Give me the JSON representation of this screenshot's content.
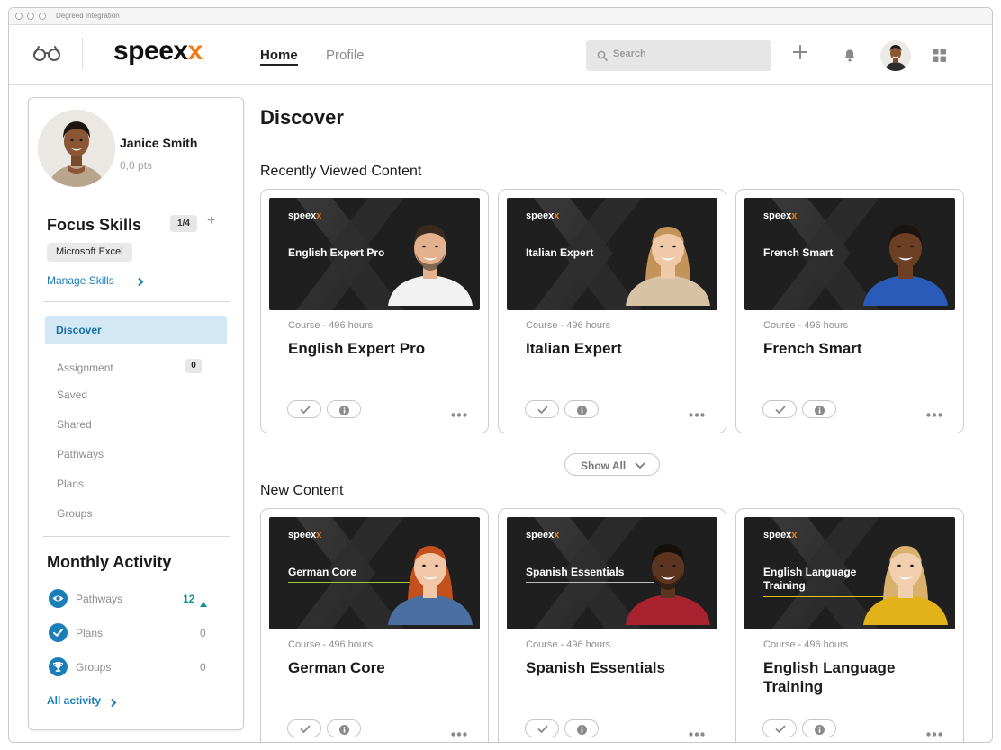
{
  "window": {
    "title": "Degreed Integration"
  },
  "brand": {
    "logo_main": "speex",
    "logo_accent": "x",
    "accent_color": "#f07c16",
    "link_color": "#1a7fb8"
  },
  "nav": {
    "home": "Home",
    "profile": "Profile"
  },
  "search": {
    "placeholder": "Search"
  },
  "icons": [
    "glasses-icon",
    "plus-icon",
    "bell-icon",
    "apps-grid-icon",
    "search-icon",
    "eye-icon",
    "check-icon",
    "trophy-icon",
    "chevron-right-icon",
    "chevron-down-icon",
    "info-icon",
    "more-icon"
  ],
  "profile": {
    "name": "Janice Smith",
    "points": "0,0 pts"
  },
  "focus_skills": {
    "title": "Focus Skills",
    "count": "1/4",
    "add": "+",
    "skills": [
      "Microsoft Excel"
    ],
    "manage_label": "Manage Skills"
  },
  "menu": {
    "active": "Discover",
    "items": [
      {
        "label": "Assignment",
        "badge": "0"
      },
      {
        "label": "Saved"
      },
      {
        "label": "Shared"
      },
      {
        "label": "Pathways"
      },
      {
        "label": "Plans"
      },
      {
        "label": "Groups"
      }
    ]
  },
  "monthly_activity": {
    "title": "Monthly Activity",
    "items": [
      {
        "label": "Pathways",
        "value": "12",
        "trend": "up",
        "icon": "eye-icon"
      },
      {
        "label": "Plans",
        "value": "0",
        "icon": "check-icon"
      },
      {
        "label": "Groups",
        "value": "0",
        "icon": "trophy-icon"
      }
    ],
    "all_label": "All activity"
  },
  "main": {
    "title": "Discover",
    "recent_title": "Recently Viewed Content",
    "show_all": "Show All",
    "new_title": "New Content",
    "thumb_logo_main": "speex",
    "thumb_logo_accent": "x",
    "recent": [
      {
        "thumb_title": "English Expert Pro",
        "meta": "Course - 496 hours",
        "title": "English Expert Pro",
        "line_color": "#f07c16"
      },
      {
        "thumb_title": "Italian Expert",
        "meta": "Course - 496 hours",
        "title": "Italian Expert",
        "line_color": "#2a9fd6"
      },
      {
        "thumb_title": "French Smart",
        "meta": "Course - 496 hours",
        "title": "French Smart",
        "line_color": "#1fb8a8"
      }
    ],
    "new": [
      {
        "thumb_title": "German Core",
        "meta": "Course - 496 hours",
        "title": "German Core",
        "line_color": "#9cc83c"
      },
      {
        "thumb_title": "Spanish Essentials",
        "meta": "Course - 496 hours",
        "title": "Spanish Essentials",
        "line_color": "#bdbdbd"
      },
      {
        "thumb_title": "English Language Training",
        "meta": "Course - 496 hours",
        "title": "English Language Training",
        "line_color": "#e8c21a"
      }
    ]
  }
}
